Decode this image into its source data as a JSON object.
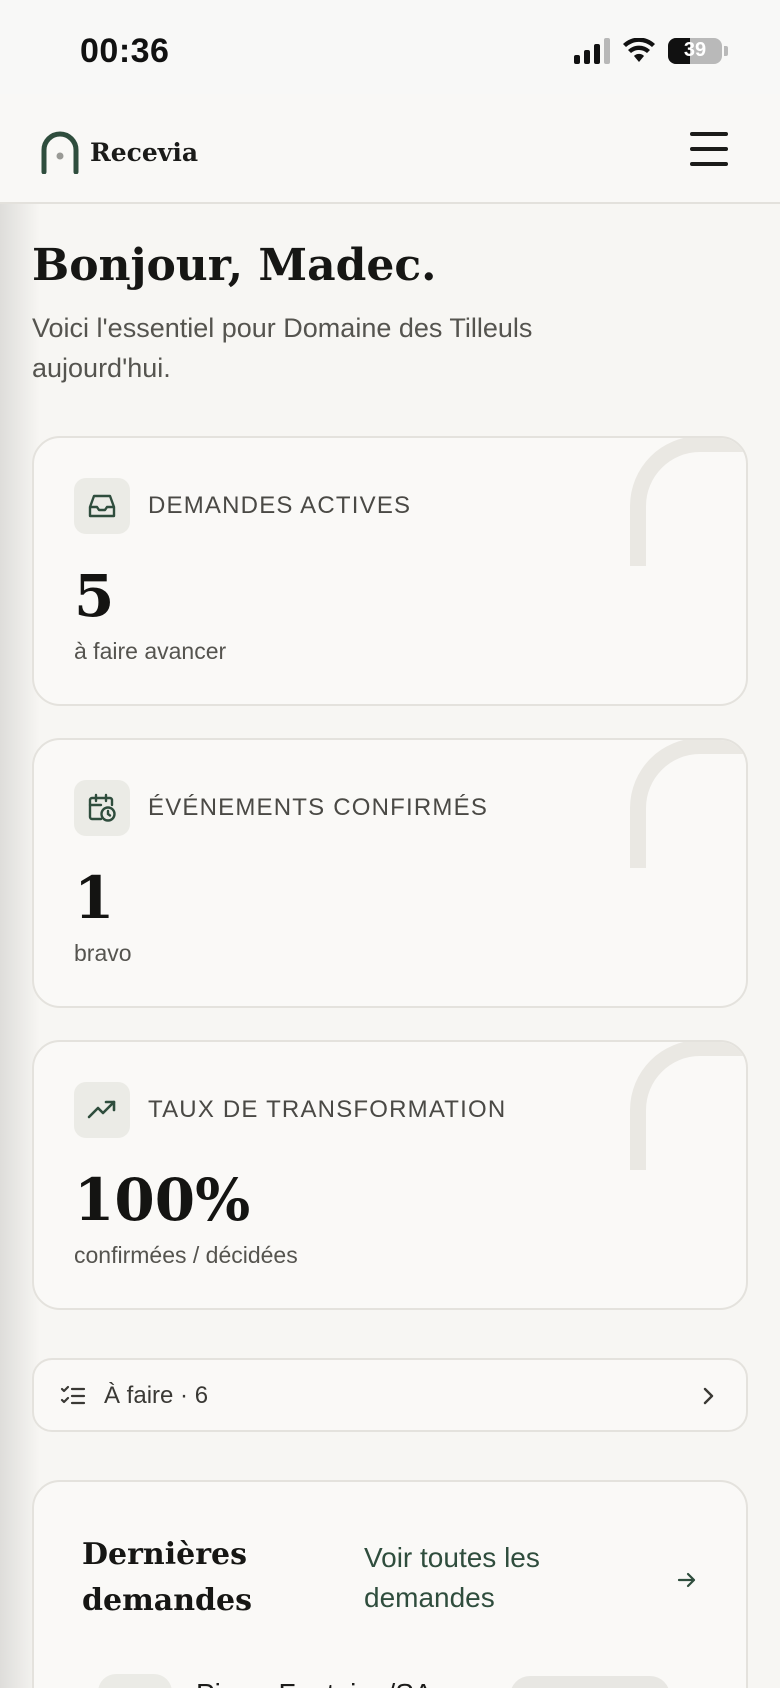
{
  "status_bar": {
    "time": "00:36",
    "battery": "39"
  },
  "header": {
    "brand": "Recevia"
  },
  "greeting": {
    "title": "Bonjour, Madec.",
    "subtitle": "Voici l'essentiel pour Domaine des Tilleuls aujourd'hui."
  },
  "stats": [
    {
      "label": "DEMANDES ACTIVES",
      "value": "5",
      "caption": "à faire avancer",
      "icon": "inbox-icon"
    },
    {
      "label": "ÉVÉNEMENTS CONFIRMÉS",
      "value": "1",
      "caption": "bravo",
      "icon": "calendar-clock-icon"
    },
    {
      "label": "TAUX DE TRANSFORMATION",
      "value": "100%",
      "caption": "confirmées / décidées",
      "icon": "trend-up-icon"
    }
  ],
  "todo": {
    "label": "À faire · 6"
  },
  "latest": {
    "title": "Dernières demandes",
    "see_all": "Voir toutes les demandes",
    "first_row_name": "Pierre Fontaine/SA"
  },
  "colors": {
    "accent": "#2f4d3d",
    "background": "#f7f6f3",
    "card": "#faf9f7"
  }
}
